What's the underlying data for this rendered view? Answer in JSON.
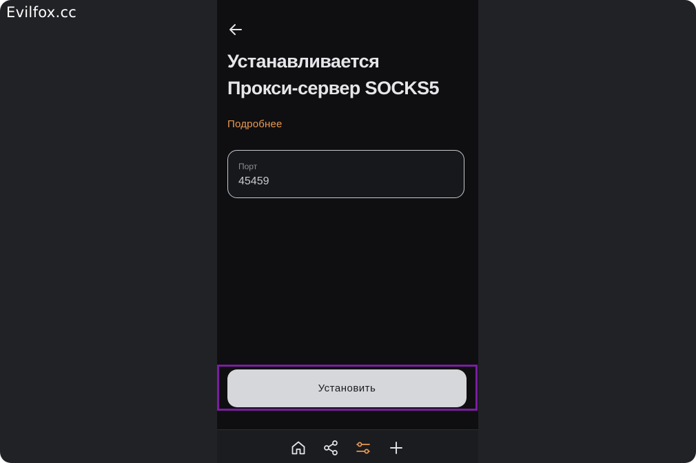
{
  "watermark": "Evilfox.cc",
  "header": {
    "back_icon": "arrow-left-icon",
    "title_line1": "Устанавливается",
    "title_line2": "Прокси-сервер SOCKS5"
  },
  "details_link": "Подробнее",
  "port_field": {
    "label": "Порт",
    "value": "45459"
  },
  "install_button": "Установить",
  "bottom_nav": {
    "items": [
      {
        "icon": "home-icon",
        "active": false
      },
      {
        "icon": "share-icon",
        "active": false
      },
      {
        "icon": "sliders-icon",
        "active": true
      },
      {
        "icon": "plus-icon",
        "active": false
      }
    ]
  },
  "colors": {
    "accent": "#e99a52",
    "phone_background": "#0f0f11",
    "outer_background": "#212226",
    "highlight_border": "#7b1ea2",
    "button_background": "#d6d7db"
  }
}
